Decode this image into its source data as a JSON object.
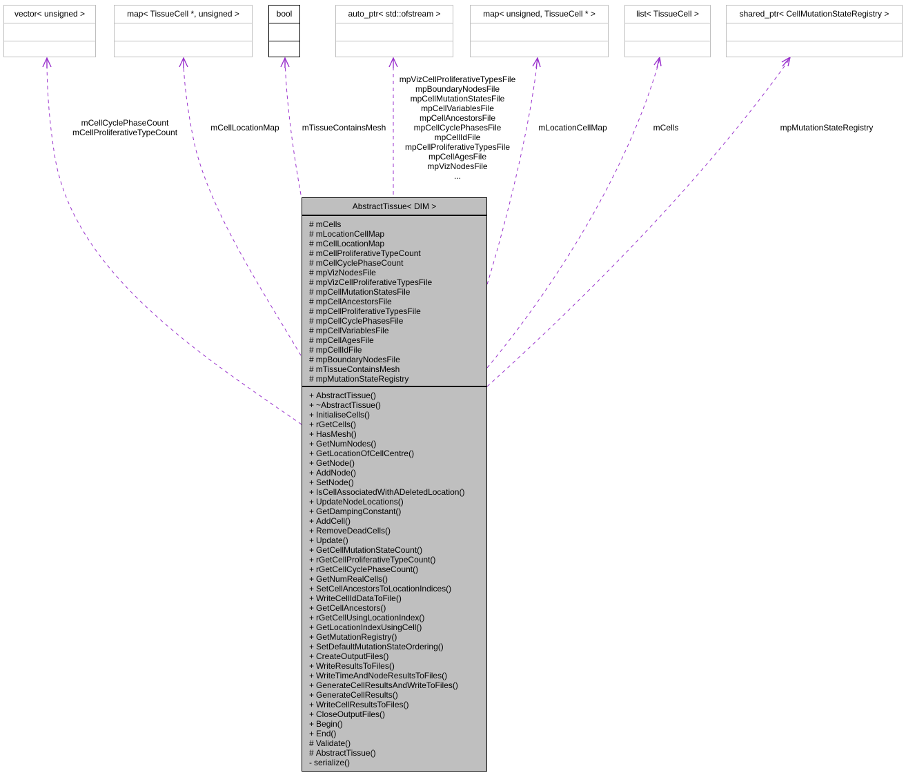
{
  "diagram": {
    "edge_color": "#9a32cd",
    "main_class": {
      "title": "AbstractTissue< DIM >",
      "fill_color": "#bfbfbf",
      "attributes": [
        {
          "vis": "#",
          "name": "mCells"
        },
        {
          "vis": "#",
          "name": "mLocationCellMap"
        },
        {
          "vis": "#",
          "name": "mCellLocationMap"
        },
        {
          "vis": "#",
          "name": "mCellProliferativeTypeCount"
        },
        {
          "vis": "#",
          "name": "mCellCyclePhaseCount"
        },
        {
          "vis": "#",
          "name": "mpVizNodesFile"
        },
        {
          "vis": "#",
          "name": "mpVizCellProliferativeTypesFile"
        },
        {
          "vis": "#",
          "name": "mpCellMutationStatesFile"
        },
        {
          "vis": "#",
          "name": "mpCellAncestorsFile"
        },
        {
          "vis": "#",
          "name": "mpCellProliferativeTypesFile"
        },
        {
          "vis": "#",
          "name": "mpCellCyclePhasesFile"
        },
        {
          "vis": "#",
          "name": "mpCellVariablesFile"
        },
        {
          "vis": "#",
          "name": "mpCellAgesFile"
        },
        {
          "vis": "#",
          "name": "mpCellIdFile"
        },
        {
          "vis": "#",
          "name": "mpBoundaryNodesFile"
        },
        {
          "vis": "#",
          "name": "mTissueContainsMesh"
        },
        {
          "vis": "#",
          "name": "mpMutationStateRegistry"
        }
      ],
      "methods": [
        {
          "vis": "+",
          "name": "AbstractTissue()"
        },
        {
          "vis": "+",
          "name": "~AbstractTissue()"
        },
        {
          "vis": "+",
          "name": "InitialiseCells()"
        },
        {
          "vis": "+",
          "name": "rGetCells()"
        },
        {
          "vis": "+",
          "name": "HasMesh()"
        },
        {
          "vis": "+",
          "name": "GetNumNodes()"
        },
        {
          "vis": "+",
          "name": "GetLocationOfCellCentre()"
        },
        {
          "vis": "+",
          "name": "GetNode()"
        },
        {
          "vis": "+",
          "name": "AddNode()"
        },
        {
          "vis": "+",
          "name": "SetNode()"
        },
        {
          "vis": "+",
          "name": "IsCellAssociatedWithADeletedLocation()"
        },
        {
          "vis": "+",
          "name": "UpdateNodeLocations()"
        },
        {
          "vis": "+",
          "name": "GetDampingConstant()"
        },
        {
          "vis": "+",
          "name": "AddCell()"
        },
        {
          "vis": "+",
          "name": "RemoveDeadCells()"
        },
        {
          "vis": "+",
          "name": "Update()"
        },
        {
          "vis": "+",
          "name": "GetCellMutationStateCount()"
        },
        {
          "vis": "+",
          "name": "rGetCellProliferativeTypeCount()"
        },
        {
          "vis": "+",
          "name": "rGetCellCyclePhaseCount()"
        },
        {
          "vis": "+",
          "name": "GetNumRealCells()"
        },
        {
          "vis": "+",
          "name": "SetCellAncestorsToLocationIndices()"
        },
        {
          "vis": "+",
          "name": "WriteCellIdDataToFile()"
        },
        {
          "vis": "+",
          "name": "GetCellAncestors()"
        },
        {
          "vis": "+",
          "name": "rGetCellUsingLocationIndex()"
        },
        {
          "vis": "+",
          "name": "GetLocationIndexUsingCell()"
        },
        {
          "vis": "+",
          "name": "GetMutationRegistry()"
        },
        {
          "vis": "+",
          "name": "SetDefaultMutationStateOrdering()"
        },
        {
          "vis": "+",
          "name": "CreateOutputFiles()"
        },
        {
          "vis": "+",
          "name": "WriteResultsToFiles()"
        },
        {
          "vis": "+",
          "name": "WriteTimeAndNodeResultsToFiles()"
        },
        {
          "vis": "+",
          "name": "GenerateCellResultsAndWriteToFiles()"
        },
        {
          "vis": "+",
          "name": "GenerateCellResults()"
        },
        {
          "vis": "+",
          "name": "WriteCellResultsToFiles()"
        },
        {
          "vis": "+",
          "name": "CloseOutputFiles()"
        },
        {
          "vis": "+",
          "name": "Begin()"
        },
        {
          "vis": "+",
          "name": "End()"
        },
        {
          "vis": "#",
          "name": "Validate()"
        },
        {
          "vis": "#",
          "name": "AbstractTissue()"
        },
        {
          "vis": "-",
          "name": "serialize()"
        }
      ]
    },
    "classes": [
      {
        "id": "vector",
        "title": "vector< unsigned >"
      },
      {
        "id": "map-cell-unsigned",
        "title": "map< TissueCell *, unsigned >"
      },
      {
        "id": "bool",
        "title": "bool"
      },
      {
        "id": "auto-ptr",
        "title": "auto_ptr< std::ofstream >"
      },
      {
        "id": "map-unsigned-cell",
        "title": "map< unsigned, TissueCell * >"
      },
      {
        "id": "list",
        "title": "list< TissueCell >"
      },
      {
        "id": "shared-ptr",
        "title": "shared_ptr< CellMutationStateRegistry >"
      }
    ],
    "edge_labels": {
      "vector": [
        "mCellCyclePhaseCount",
        "mCellProliferativeTypeCount"
      ],
      "map-cell-unsigned": [
        "mCellLocationMap"
      ],
      "bool": [
        "mTissueContainsMesh"
      ],
      "auto-ptr": [
        "mpVizCellProliferativeTypesFile",
        "mpBoundaryNodesFile",
        "mpCellMutationStatesFile",
        "mpCellVariablesFile",
        "mpCellAncestorsFile",
        "mpCellCyclePhasesFile",
        "mpCellIdFile",
        "mpCellProliferativeTypesFile",
        "mpCellAgesFile",
        "mpVizNodesFile",
        "..."
      ],
      "map-unsigned-cell": [
        "mLocationCellMap"
      ],
      "list": [
        "mCells"
      ],
      "shared-ptr": [
        "mpMutationStateRegistry"
      ]
    }
  }
}
